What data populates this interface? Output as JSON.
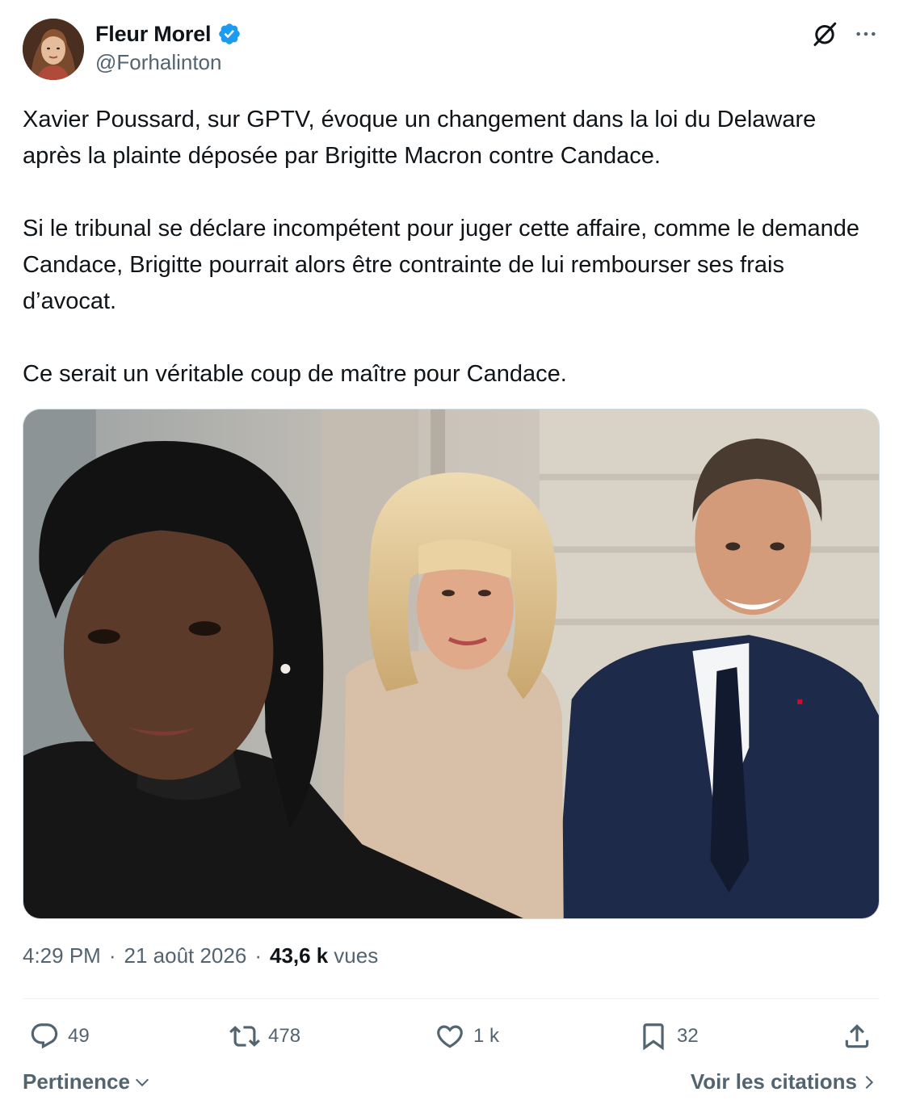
{
  "author": {
    "display_name": "Fleur Morel",
    "handle": "@Forhalinton",
    "verified": true,
    "verified_color": "#1d9bf0"
  },
  "header_icons": [
    "grok-icon",
    "more-icon"
  ],
  "tweet": {
    "paragraphs": [
      "Xavier Poussard, sur GPTV, évoque un changement dans la loi du Delaware après la plainte déposée par Brigitte Macron contre Candace.",
      "Si le tribunal se déclare incompétent pour juger cette affaire, comme le demande Candace, Brigitte pourrait alors être contrainte de lui rembourser ses frais d’avocat.",
      "Ce serait un véritable coup de maître pour Candace."
    ]
  },
  "meta": {
    "time": "4:29 PM",
    "date": "21 août 2026",
    "views_count": "43,6 k",
    "views_label": "vues"
  },
  "actions": {
    "reply": {
      "icon": "reply-icon",
      "count": "49"
    },
    "repost": {
      "icon": "repost-icon",
      "count": "478"
    },
    "like": {
      "icon": "heart-icon",
      "count": "1 k"
    },
    "bookmark": {
      "icon": "bookmark-icon",
      "count": "32"
    },
    "share": {
      "icon": "share-icon"
    }
  },
  "footer": {
    "sort_label": "Pertinence",
    "quotes_label": "Voir les citations"
  },
  "colors": {
    "text": "#0f1419",
    "secondary": "#536471",
    "divider": "#eff3f4"
  }
}
